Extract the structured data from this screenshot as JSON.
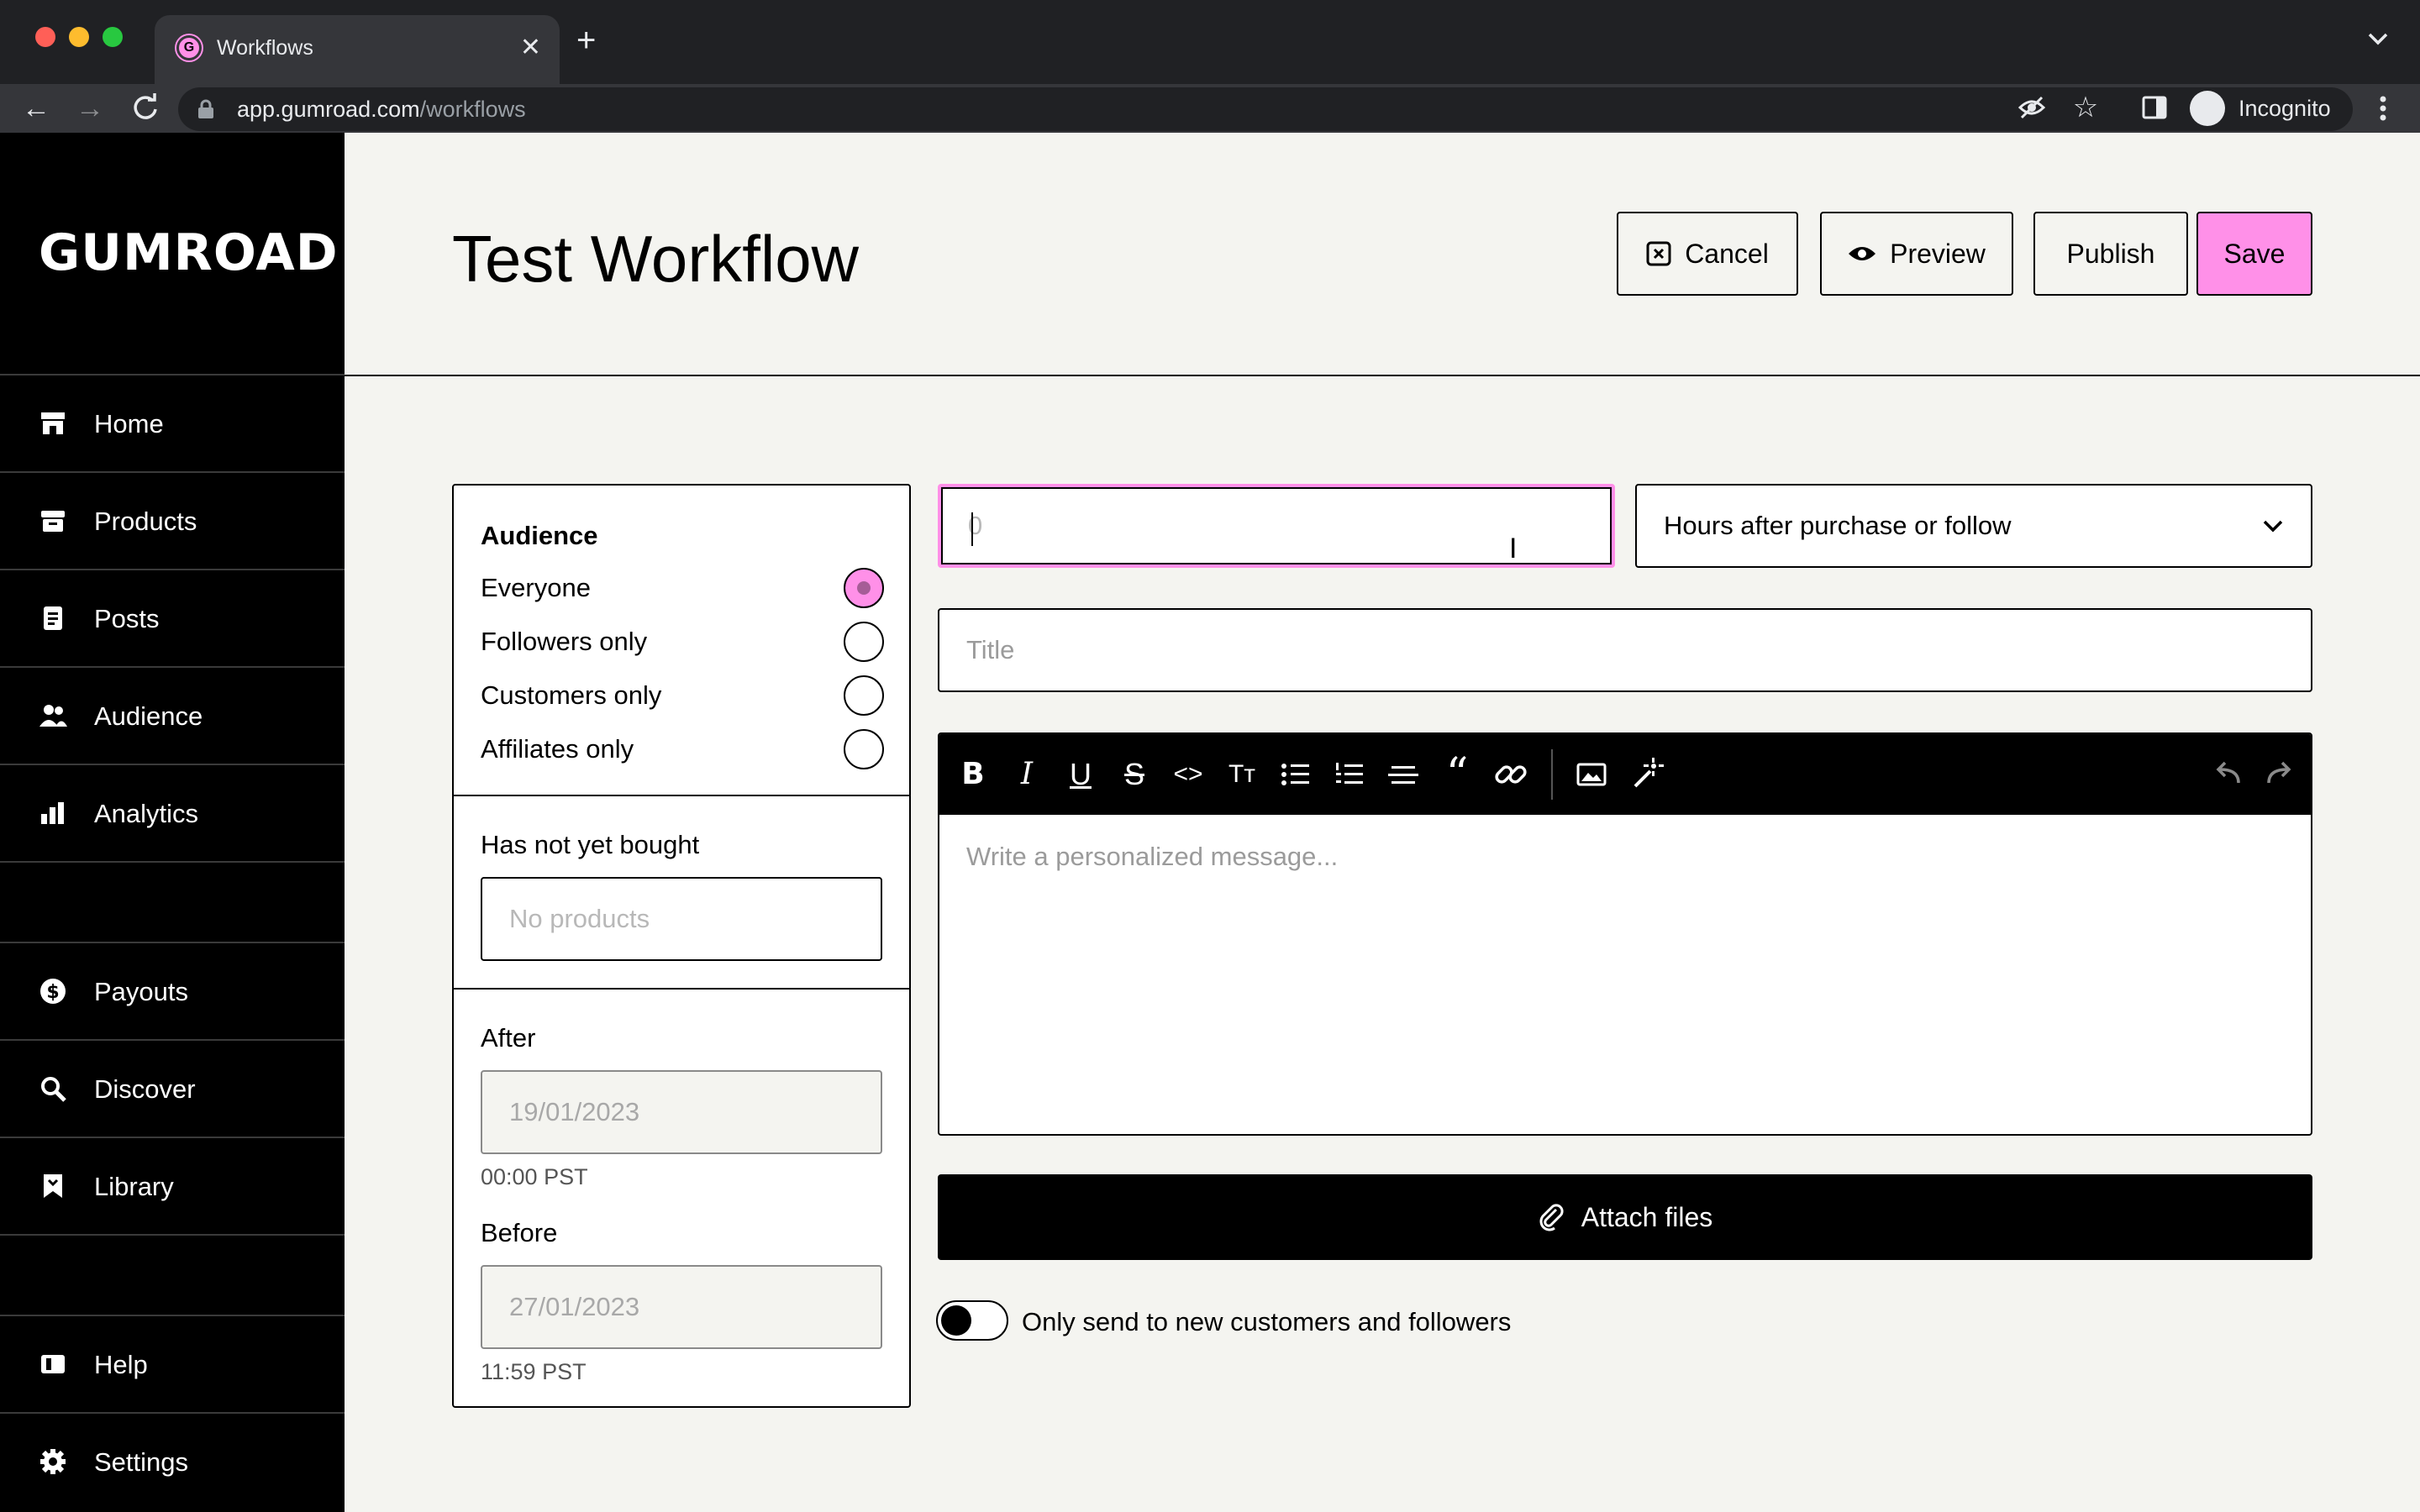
{
  "browser": {
    "tab_title": "Workflows",
    "tab_favicon": "G",
    "url_host": "app.gumroad.com",
    "url_path": "/workflows",
    "incognito_label": "Incognito"
  },
  "sidebar": {
    "logo": "GUMROAD",
    "items": [
      {
        "label": "Home",
        "icon": "store-icon"
      },
      {
        "label": "Products",
        "icon": "archive-icon"
      },
      {
        "label": "Posts",
        "icon": "document-icon"
      },
      {
        "label": "Audience",
        "icon": "people-icon"
      },
      {
        "label": "Analytics",
        "icon": "bar-chart-icon"
      },
      {
        "label": "Payouts",
        "icon": "dollar-icon"
      },
      {
        "label": "Discover",
        "icon": "search-icon"
      },
      {
        "label": "Library",
        "icon": "bookmark-icon"
      },
      {
        "label": "Help",
        "icon": "book-icon"
      },
      {
        "label": "Settings",
        "icon": "gear-icon"
      }
    ]
  },
  "header": {
    "title": "Test Workflow",
    "cancel": "Cancel",
    "preview": "Preview",
    "publish": "Publish",
    "save": "Save"
  },
  "audience": {
    "title": "Audience",
    "options": [
      {
        "label": "Everyone",
        "checked": true
      },
      {
        "label": "Followers only",
        "checked": false
      },
      {
        "label": "Customers only",
        "checked": false
      },
      {
        "label": "Affiliates only",
        "checked": false
      }
    ],
    "not_bought_label": "Has not yet bought",
    "not_bought_placeholder": "No products",
    "after_label": "After",
    "after_date": "19/01/2023",
    "after_time": "00:00 PST",
    "before_label": "Before",
    "before_date": "27/01/2023",
    "before_time": "11:59 PST"
  },
  "form": {
    "delay_placeholder": "0",
    "delay_unit": "Hours after purchase or follow",
    "title_placeholder": "Title",
    "message_placeholder": "Write a personalized message...",
    "attach_label": "Attach files",
    "toggle_label": "Only send to new customers and followers",
    "toggle_on": false
  },
  "colors": {
    "accent": "#ff90e8",
    "background": "#f4f4f0",
    "sidebar": "#000000"
  }
}
